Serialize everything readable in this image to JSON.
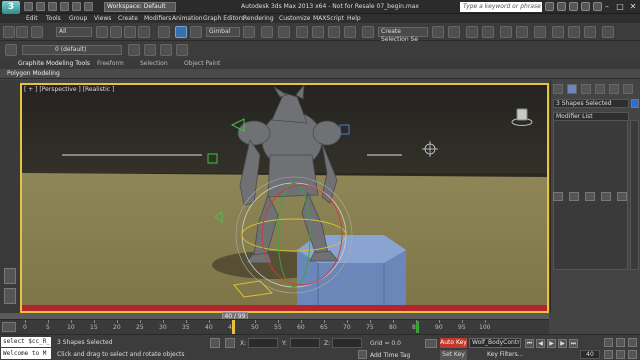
{
  "titlebar": {
    "title": "Autodesk 3ds Max  2013 x64  - Not for Resale   07_begin.max",
    "workspace": "Workspace: Default",
    "search_placeholder": "Type a keyword or phrase",
    "logo": "3"
  },
  "menu": [
    "Edit",
    "Tools",
    "Group",
    "Views",
    "Create",
    "Modifiers",
    "Animation",
    "Graph Editors",
    "Rendering",
    "Customize",
    "MAXScript",
    "Help"
  ],
  "toolbar": {
    "filter": "All",
    "ref_coord": "Gimbal",
    "named_selection": "Create Selection Se"
  },
  "toolbar2": {
    "layer": "0 (default)"
  },
  "ribbon": {
    "tabs": [
      "Graphite Modeling Tools",
      "Freeform",
      "Selection",
      "Object Paint"
    ],
    "panel": "Polygon Modeling"
  },
  "viewport": {
    "label": "[ + ] [Perspective ] [Realistic ]",
    "ground_color": "#8f8657",
    "horizon_color": "#2a2822"
  },
  "command_panel": {
    "selection": "3 Shapes Selected",
    "modifier_list": "Modifier List",
    "selection_color": "#2e6dd4"
  },
  "timeline": {
    "current": "40 / 99",
    "ticks": [
      "0",
      "5",
      "10",
      "15",
      "20",
      "25",
      "30",
      "35",
      "40",
      "45",
      "50",
      "55",
      "60",
      "65",
      "70",
      "75",
      "80",
      "85",
      "90",
      "95",
      "100"
    ]
  },
  "status": {
    "maxscript_line1": "select $cc_R_",
    "maxscript_line2": "Welcome to M",
    "selected": "3 Shapes Selected",
    "prompt": "Click and drag to select and rotate objects",
    "x_label": "X:",
    "y_label": "Y:",
    "z_label": "Z:",
    "grid": "Grid = 0.0",
    "add_time_tag": "Add Time Tag",
    "auto_key": "Auto Key",
    "set_key": "Set Key",
    "selected_set": "Wolf_BodyControl",
    "key_filters": "Key Filters...",
    "current_frame": "40"
  }
}
